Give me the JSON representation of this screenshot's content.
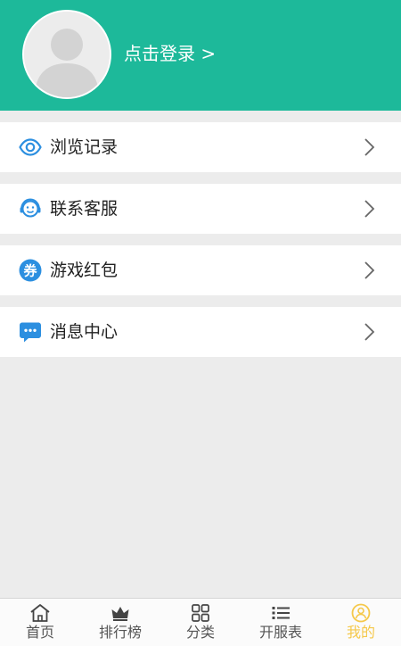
{
  "header": {
    "login_label": "点击登录 >",
    "accent_color": "#1db99a"
  },
  "menu": [
    {
      "label": "浏览记录",
      "icon": "eye-icon"
    },
    {
      "label": "联系客服",
      "icon": "customer-service-icon"
    },
    {
      "label": "游戏红包",
      "icon": "coupon-icon"
    },
    {
      "label": "消息中心",
      "icon": "message-icon"
    }
  ],
  "tabbar": {
    "tabs": [
      {
        "label": "首页",
        "icon": "home-icon"
      },
      {
        "label": "排行榜",
        "icon": "crown-icon"
      },
      {
        "label": "分类",
        "icon": "grid-icon"
      },
      {
        "label": "开服表",
        "icon": "list-icon"
      },
      {
        "label": "我的",
        "icon": "profile-icon",
        "active": true
      }
    ],
    "active_color": "#f5c84a"
  }
}
